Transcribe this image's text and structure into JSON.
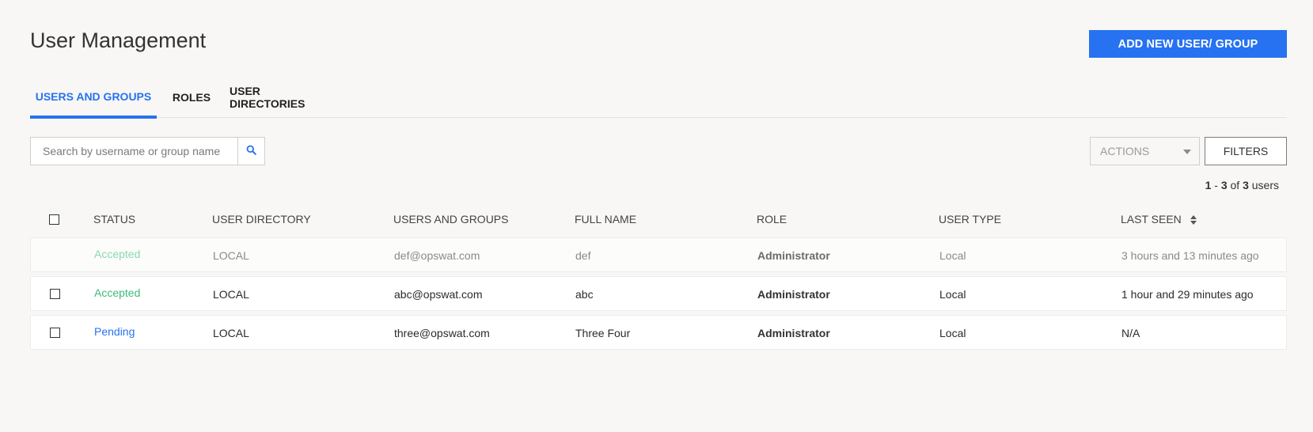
{
  "page": {
    "title": "User Management"
  },
  "header": {
    "add_button_label": "ADD NEW USER/ GROUP"
  },
  "tabs": [
    {
      "label": "USERS AND GROUPS",
      "active": true
    },
    {
      "label": "ROLES",
      "active": false
    },
    {
      "label": "USER DIRECTORIES",
      "active": false
    }
  ],
  "search": {
    "placeholder": "Search by username or group name",
    "value": ""
  },
  "toolbar": {
    "actions_label": "ACTIONS",
    "filters_label": "FILTERS"
  },
  "pagination": {
    "start": "1",
    "end": "3",
    "of_label": "of",
    "total": "3",
    "unit": "users"
  },
  "table": {
    "columns": [
      "STATUS",
      "USER DIRECTORY",
      "USERS AND GROUPS",
      "FULL NAME",
      "ROLE",
      "USER TYPE",
      "LAST SEEN"
    ],
    "rows": [
      {
        "status": "Accepted",
        "directory": "LOCAL",
        "user": "def@opswat.com",
        "full_name": "def",
        "role": "Administrator",
        "user_type": "Local",
        "last_seen": "3 hours and 13 minutes ago"
      },
      {
        "status": "Accepted",
        "directory": "LOCAL",
        "user": "abc@opswat.com",
        "full_name": "abc",
        "role": "Administrator",
        "user_type": "Local",
        "last_seen": "1 hour and 29 minutes ago"
      },
      {
        "status": "Pending",
        "directory": "LOCAL",
        "user": "three@opswat.com",
        "full_name": "Three Four",
        "role": "Administrator",
        "user_type": "Local",
        "last_seen": "N/A"
      }
    ]
  },
  "colors": {
    "accent": "#2672f0",
    "accepted": "#3dbb7a",
    "background": "#f8f7f5"
  },
  "icons": {
    "search": "search-icon",
    "sort": "sort-icon",
    "dropdown": "chevron-down-icon"
  }
}
